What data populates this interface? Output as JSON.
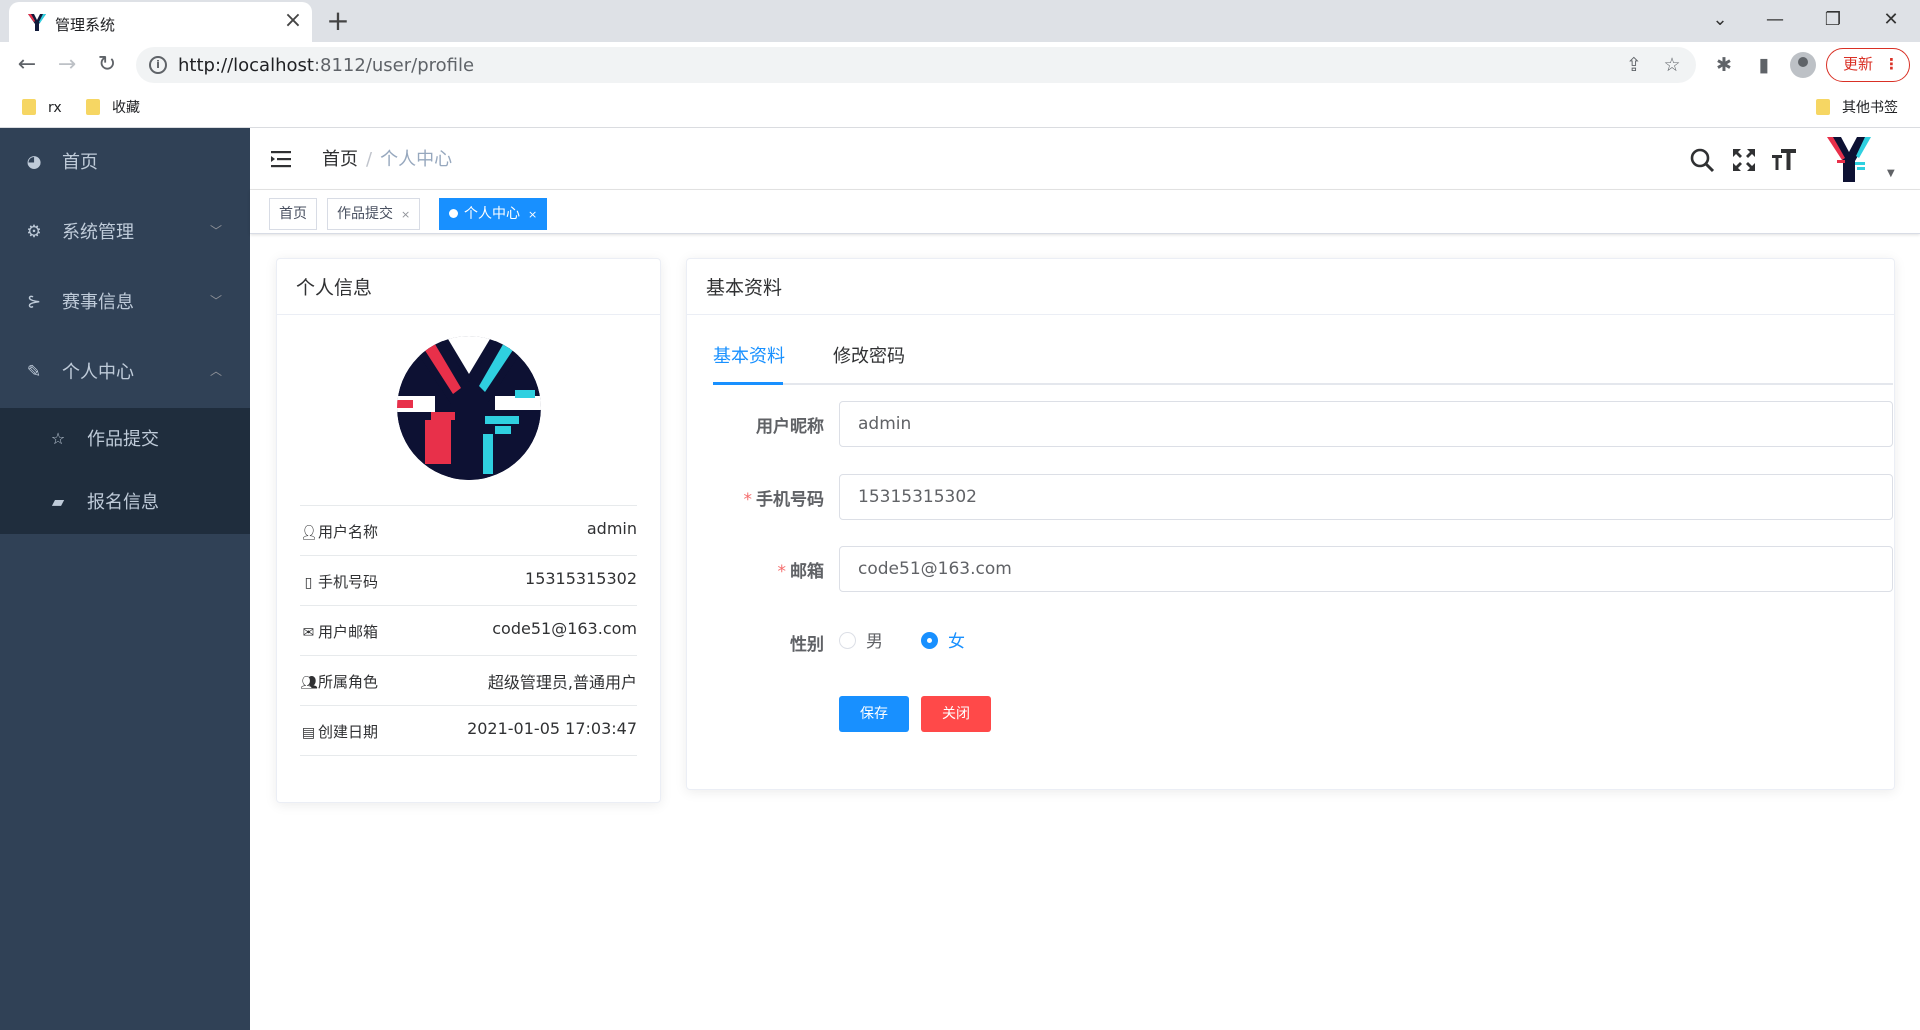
{
  "browser": {
    "tab_title": "管理系统",
    "tab_close": "×",
    "new_tab": "+",
    "url_host": "http://localhost",
    "url_rest": ":8112/user/profile",
    "update_label": "更新",
    "update_dots": "⋮",
    "bookmarks": [
      "rx",
      "收藏"
    ],
    "other_bookmarks": "其他书签"
  },
  "sidebar": {
    "items": [
      {
        "label": "首页",
        "icon": "dashboard-icon"
      },
      {
        "label": "系统管理",
        "icon": "gear-icon"
      },
      {
        "label": "赛事信息",
        "icon": "tree-icon"
      },
      {
        "label": "个人中心",
        "icon": "edit-icon"
      }
    ],
    "subitems": [
      {
        "label": "作品提交",
        "icon": "star-icon"
      },
      {
        "label": "报名信息",
        "icon": "message-icon"
      }
    ]
  },
  "header": {
    "breadcrumb": [
      "首页",
      "个人中心"
    ],
    "breadcrumb_sep": "/"
  },
  "tags": [
    {
      "label": "首页"
    },
    {
      "label": "作品提交"
    },
    {
      "label": "个人中心",
      "active": true
    }
  ],
  "tag_close": "×",
  "profile_card": {
    "title": "个人信息",
    "rows": [
      {
        "key": "用户名称",
        "value": "admin",
        "icon": "user-icon"
      },
      {
        "key": "手机号码",
        "value": "15315315302",
        "icon": "phone-icon"
      },
      {
        "key": "用户邮箱",
        "value": "code51@163.com",
        "icon": "mail-icon"
      },
      {
        "key": "所属角色",
        "value": "超级管理员,普通用户",
        "icon": "group-icon"
      },
      {
        "key": "创建日期",
        "value": "2021-01-05 17:03:47",
        "icon": "calendar-icon"
      }
    ]
  },
  "basic_card": {
    "title": "基本资料",
    "tabs": [
      "基本资料",
      "修改密码"
    ],
    "form": {
      "nickname_label": "用户昵称",
      "nickname_value": "admin",
      "phone_label": "手机号码",
      "phone_value": "15315315302",
      "email_label": "邮箱",
      "email_value": "code51@163.com",
      "required_mark": "*",
      "gender_label": "性别",
      "gender_options": [
        "男",
        "女"
      ],
      "gender_selected": "女",
      "save_label": "保存",
      "close_label": "关闭"
    }
  },
  "colors": {
    "sidebar_bg": "#304156",
    "submenu_bg": "#1f2d3d",
    "primary": "#1890ff",
    "danger": "#ff4949"
  }
}
